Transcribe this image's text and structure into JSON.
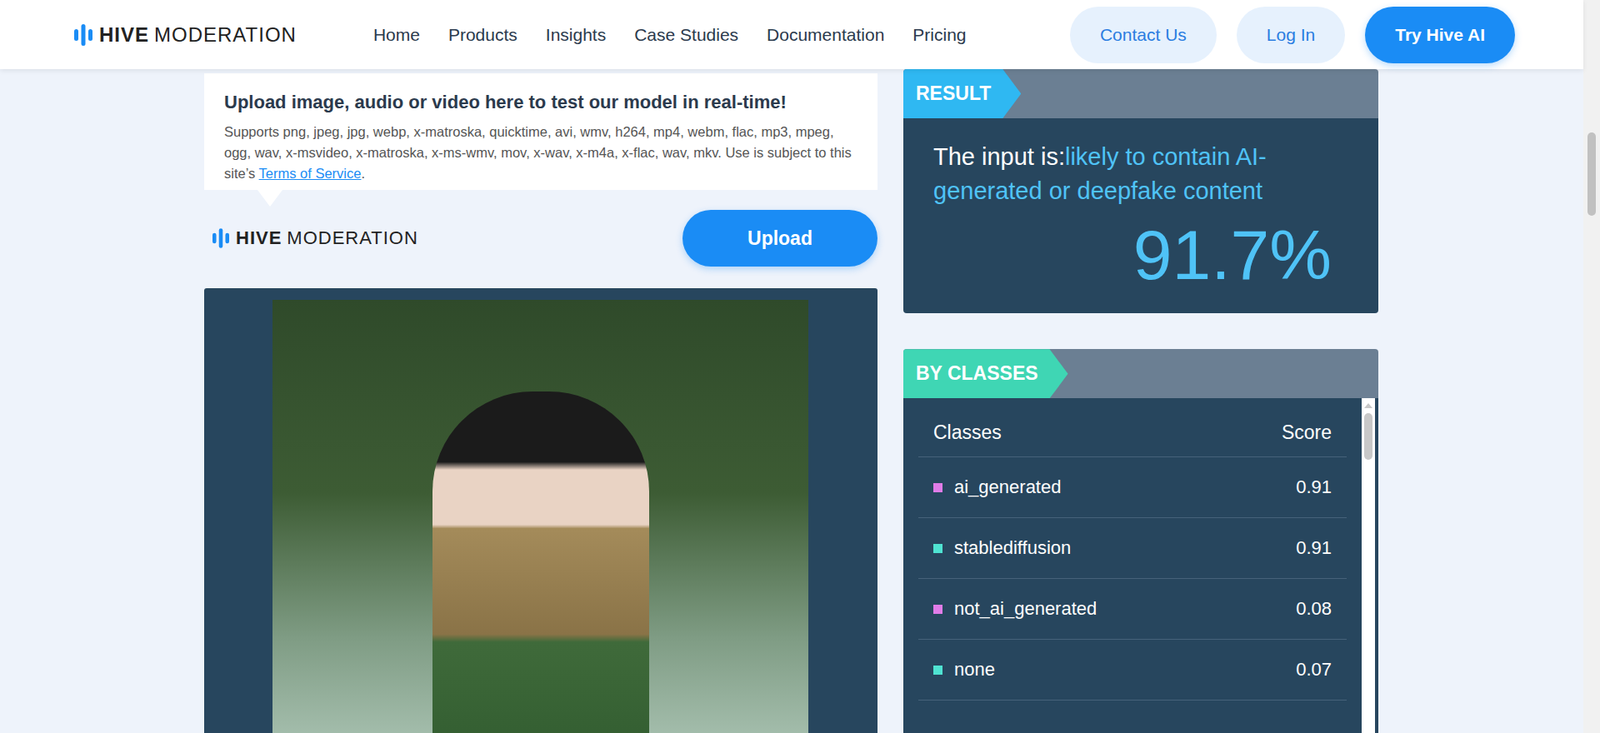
{
  "header": {
    "logo": {
      "brand": "HIVE",
      "product": "MODERATION"
    },
    "nav": [
      "Home",
      "Products",
      "Insights",
      "Case Studies",
      "Documentation",
      "Pricing"
    ],
    "buttons": [
      {
        "label": "Contact Us",
        "kind": "secondary"
      },
      {
        "label": "Log In",
        "kind": "secondary"
      },
      {
        "label": "Try Hive AI",
        "kind": "primary"
      }
    ]
  },
  "upload": {
    "title": "Upload image, audio or video here to test our model in real-time!",
    "description": "Supports png, jpeg, jpg, webp, x-matroska, quicktime, avi, wmv, h264, mp4, webm, flac, mp3, mpeg, ogg, wav, x-msvideo, x-matroska, x-ms-wmv, mov, x-wav, x-m4a, x-flac, wav, mkv. Use is subject to this site’s ",
    "link": "Terms of Service",
    "after_link": ".",
    "logo": {
      "brand": "HIVE",
      "product": "MODERATION"
    },
    "button": "Upload"
  },
  "result": {
    "tag": "RESULT",
    "prefix": "The input is:",
    "verdict": "likely to contain AI-generated or deepfake content",
    "score": "91.7%"
  },
  "classes": {
    "tag": "BY CLASSES",
    "columns": [
      "Classes",
      "Score"
    ],
    "rows": [
      {
        "name": "ai_generated",
        "score": "0.91",
        "color": "#e07ce8"
      },
      {
        "name": "stablediffusion",
        "score": "0.91",
        "color": "#4fe3d2"
      },
      {
        "name": "not_ai_generated",
        "score": "0.08",
        "color": "#e07ce8"
      },
      {
        "name": "none",
        "score": "0.07",
        "color": "#4fe3d2"
      }
    ]
  }
}
